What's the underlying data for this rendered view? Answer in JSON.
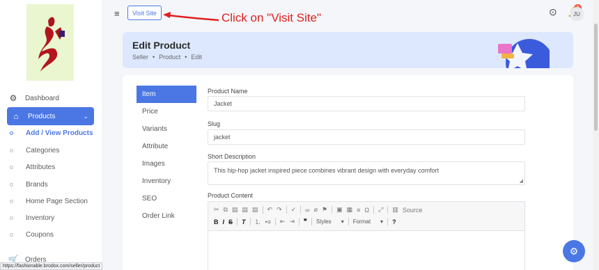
{
  "sidebar": {
    "logo_icon": "fashion-logo",
    "items": [
      {
        "label": "Dashboard",
        "icon": "dashboard-icon"
      },
      {
        "label": "Products",
        "icon": "store-icon"
      },
      {
        "label": "Orders",
        "icon": "cart-icon"
      }
    ],
    "sub_items": [
      {
        "label": "Add / View Products"
      },
      {
        "label": "Categories"
      },
      {
        "label": "Attributes"
      },
      {
        "label": "Brands"
      },
      {
        "label": "Home Page Section"
      },
      {
        "label": "Inventory"
      },
      {
        "label": "Coupons"
      }
    ]
  },
  "topbar": {
    "visit_site_label": "Visit Site",
    "annotation_text": "Click on \"Visit Site\"",
    "notification_count": "2",
    "avatar_initials": "JU"
  },
  "header": {
    "title": "Edit Product",
    "breadcrumb": [
      "Seller",
      "Product",
      "Edit"
    ]
  },
  "tabs": [
    "Item",
    "Price",
    "Variants",
    "Attribute",
    "Images",
    "Inventory",
    "SEO",
    "Order Link"
  ],
  "form": {
    "product_name_label": "Product Name",
    "product_name_value": "Jacket",
    "slug_label": "Slug",
    "slug_value": "jacket",
    "short_description_label": "Short Description",
    "short_description_value": "This hip-hop jacket inspired piece combines vibrant design with everyday comfort",
    "product_content_label": "Product Content"
  },
  "editor": {
    "source_label": "Source",
    "styles_label": "Styles",
    "format_label": "Format"
  },
  "status_url": "https://fashionable.brodox.com/seller/product",
  "colors": {
    "primary": "#4a77e4",
    "annotation": "#e01e1e",
    "header_bg": "#dde8ff"
  }
}
